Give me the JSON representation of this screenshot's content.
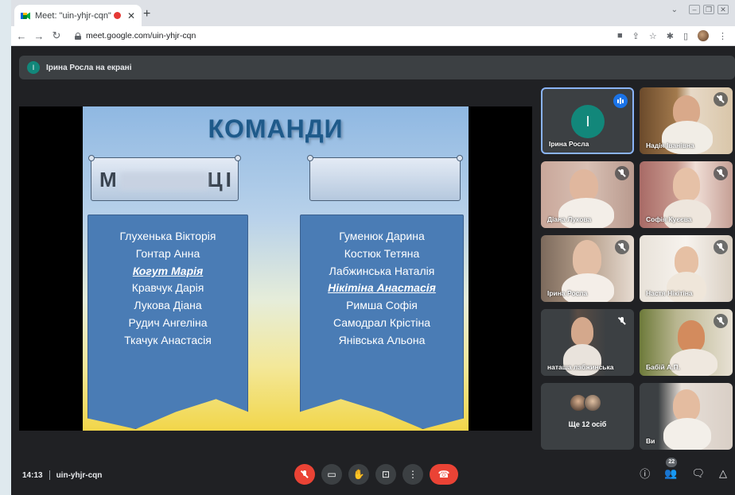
{
  "browser": {
    "tab_title": "Meet: \"uin-yhjr-cqn\"",
    "tab_close": "✕",
    "new_tab": "+",
    "url": "meet.google.com/uin-yhjr-cqn"
  },
  "meet": {
    "presenting_initial": "І",
    "presenting_text": "Ірина Росла на екрані",
    "time": "14:13",
    "meeting_code": "uin-yhjr-cqn",
    "participant_count": "22"
  },
  "slide": {
    "title": "КОМАНДИ",
    "left_header_partial_start": "М",
    "left_header_partial_end": "ЦІ",
    "left_team": [
      {
        "name": "Глухенька Вікторія",
        "em": false
      },
      {
        "name": "Гонтар Анна",
        "em": false
      },
      {
        "name": "Когут Марія",
        "em": true
      },
      {
        "name": "Кравчук Дарія",
        "em": false
      },
      {
        "name": "Лукова Діана",
        "em": false
      },
      {
        "name": "Рудич Ангеліна",
        "em": false
      },
      {
        "name": "Ткачук Анастасія",
        "em": false
      }
    ],
    "right_team": [
      {
        "name": "Гуменюк Дарина",
        "em": false
      },
      {
        "name": "Костюк Тетяна",
        "em": false
      },
      {
        "name": "Лабжинська Наталія",
        "em": false
      },
      {
        "name": "Нікітіна Анастасія",
        "em": true
      },
      {
        "name": "Римша Софія",
        "em": false
      },
      {
        "name": "Самодрал Крістіна",
        "em": false
      },
      {
        "name": "Янівська Альона",
        "em": false
      }
    ]
  },
  "participants": {
    "p1": {
      "name": "Ірина Росла",
      "initial": "І"
    },
    "p2": {
      "name": "Надія Іванівна"
    },
    "p3": {
      "name": "Діана Лукова"
    },
    "p4": {
      "name": "Софія Куєєва"
    },
    "p5": {
      "name": "Ірина Росла"
    },
    "p6": {
      "name": "Настя Нікітіна"
    },
    "p7": {
      "name": "наташа лабжинська"
    },
    "p8": {
      "name": "Бабій А.П."
    },
    "more": {
      "label": "Ще 12 осіб"
    },
    "self": {
      "name": "Ви"
    }
  },
  "colors": {
    "meet_bg": "#202124",
    "tile_bg": "#3c4043",
    "accent_blue": "#8ab4f8",
    "end_call_red": "#ea4335",
    "avatar_teal": "#12877a"
  }
}
